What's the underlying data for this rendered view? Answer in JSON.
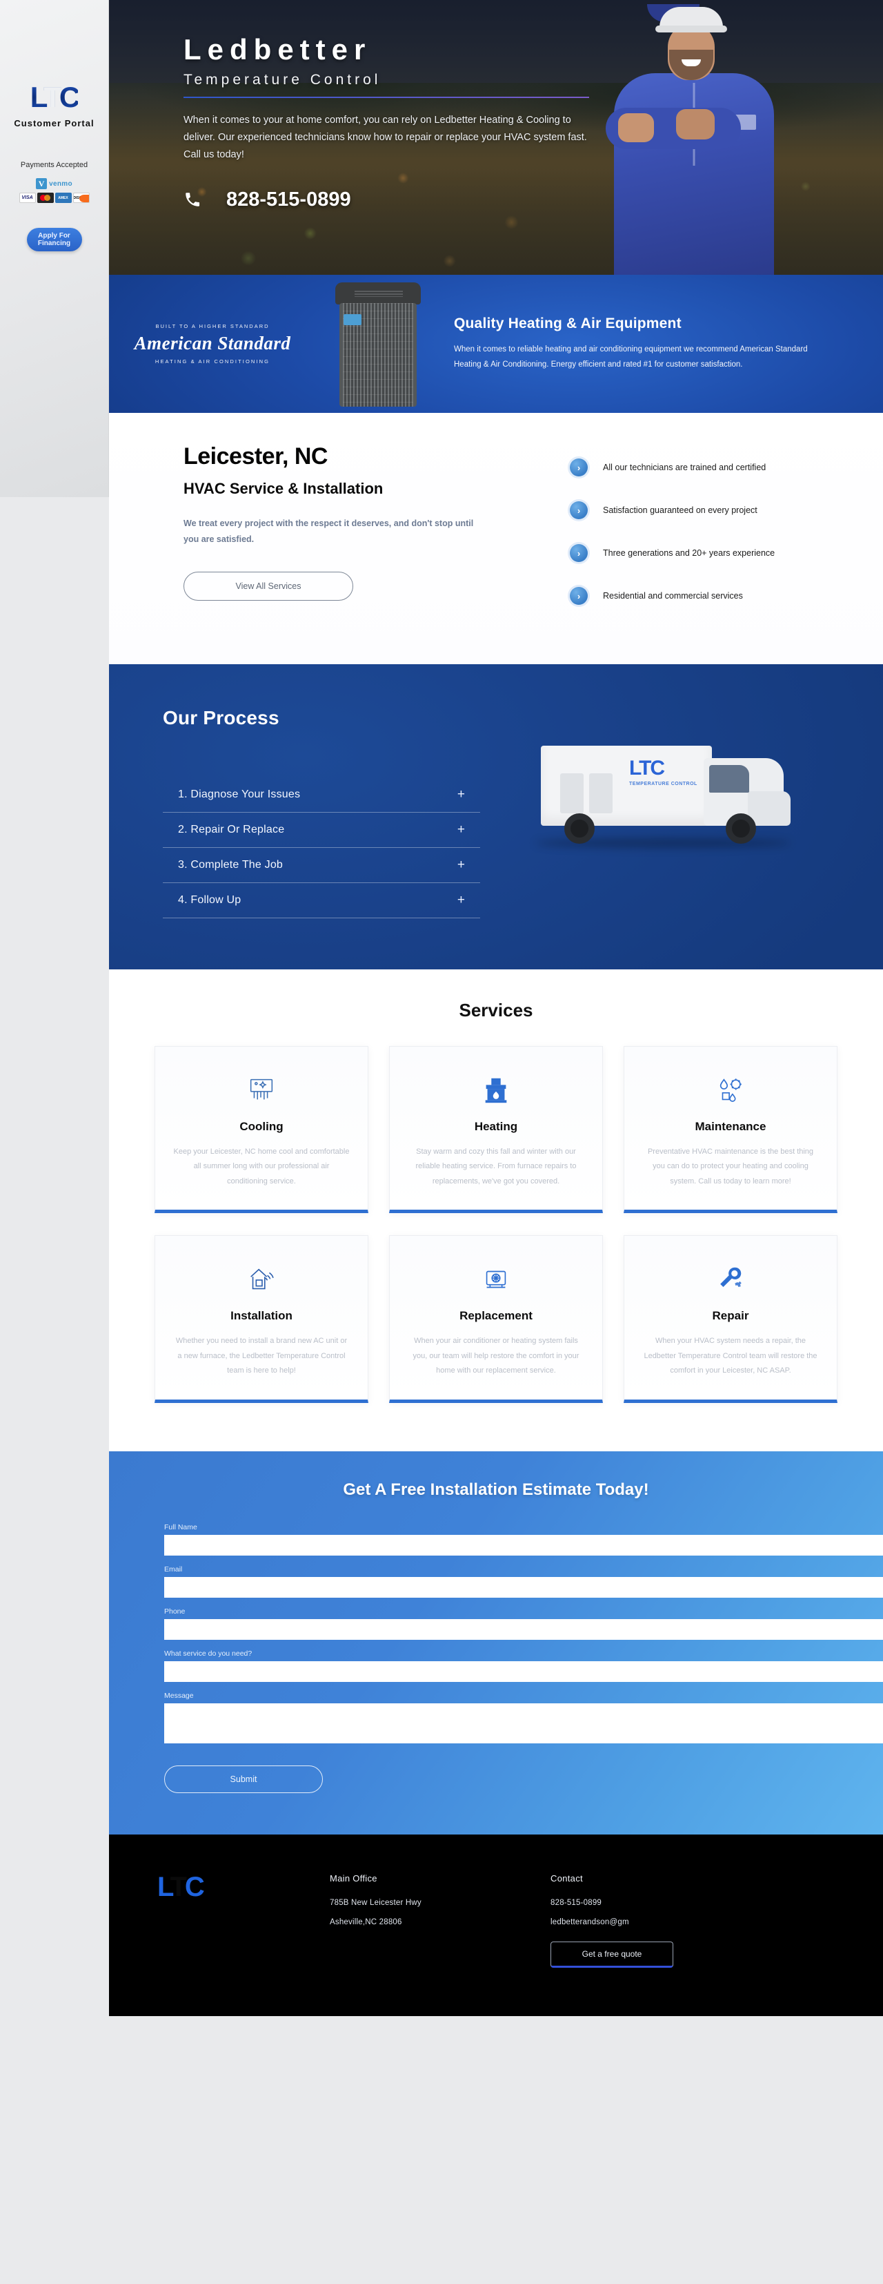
{
  "sidebar": {
    "logo_text": "LTC",
    "portal_label": "Customer Portal",
    "payments_title": "Payments Accepted",
    "payment_badges": [
      {
        "name": "venmo",
        "label": "venmo",
        "mark": "V"
      },
      {
        "name": "visa",
        "label": "VISA"
      },
      {
        "name": "mastercard",
        "label": ""
      },
      {
        "name": "amex",
        "label": "AMEX"
      },
      {
        "name": "discover",
        "label": "DISCVER"
      }
    ],
    "financing_button": "Apply For Financing"
  },
  "hero": {
    "title": "Ledbetter",
    "subtitle": "Temperature Control",
    "lede": "When it comes to your at home comfort, you can rely on Ledbetter Heating & Cooling to deliver. Our experienced technicians know how to repair or replace your HVAC system fast. Call us today!",
    "phone": "828-515-0899",
    "phone_icon": "phone-icon"
  },
  "brand_band": {
    "brand_tagline": "BUILT TO A HIGHER STANDARD",
    "brand_name": "American Standard",
    "brand_sub": "HEATING & AIR CONDITIONING",
    "heading": "Quality Heating & Air Equipment",
    "body": "When it comes to reliable heating and air conditioning equipment we recommend American Standard Heating & Air Conditioning. Energy efficient and rated #1 for customer satisfaction."
  },
  "intro": {
    "city": "Leicester, NC",
    "subtitle": "HVAC Service & Installation",
    "paragraph": "We treat every project with the respect it deserves, and don't stop until you are satisfied.",
    "cta": "View All Services",
    "bullets": [
      "All our technicians are trained and certified",
      "Satisfaction guaranteed on every project",
      "Three generations and 20+ years experience",
      "Residential and commercial services"
    ]
  },
  "process": {
    "heading": "Our Process",
    "steps": [
      {
        "label": "1. Diagnose Your Issues",
        "toggle": "+"
      },
      {
        "label": "2. Repair Or Replace",
        "toggle": "+"
      },
      {
        "label": "3. Complete The Job",
        "toggle": "+"
      },
      {
        "label": "4. Follow Up",
        "toggle": "+"
      }
    ],
    "van_logo": "LTC",
    "van_logo_sub": "TEMPERATURE CONTROL"
  },
  "services": {
    "heading": "Services",
    "cards": [
      {
        "icon": "air-vent-icon",
        "title": "Cooling",
        "body": "Keep your Leicester, NC home cool and comfortable all summer long with our professional air conditioning service."
      },
      {
        "icon": "fireplace-icon",
        "title": "Heating",
        "body": "Stay warm and cozy this fall and winter with our reliable heating service. From furnace repairs to replacements, we've got you covered."
      },
      {
        "icon": "maintenance-gear-icon",
        "title": "Maintenance",
        "body": "Preventative HVAC maintenance is the best thing you can do to protect your heating and cooling system. Call us today to learn more!"
      },
      {
        "icon": "house-install-icon",
        "title": "Installation",
        "body": "Whether you need to install a brand new AC unit or a new furnace, the Ledbetter Temperature Control team is here to help!"
      },
      {
        "icon": "hvac-unit-icon",
        "title": "Replacement",
        "body": "When your air conditioner or heating system fails you, our team will help restore the comfort in your home with our replacement service."
      },
      {
        "icon": "wrench-gear-icon",
        "title": "Repair",
        "body": "When your HVAC system needs a repair, the Ledbetter Temperature Control team will restore the comfort in your Leicester, NC ASAP."
      }
    ]
  },
  "estimate": {
    "heading": "Get A Free Installation Estimate Today!",
    "fields": [
      {
        "name": "full-name",
        "label": "Full Name",
        "value": "",
        "type": "text"
      },
      {
        "name": "email",
        "label": "Email",
        "value": "",
        "type": "text"
      },
      {
        "name": "phone",
        "label": "Phone",
        "value": "",
        "type": "text"
      },
      {
        "name": "service-needed",
        "label": "What service do you need?",
        "value": "",
        "type": "text"
      },
      {
        "name": "message",
        "label": "Message",
        "value": "",
        "type": "textarea"
      }
    ],
    "submit_label": "Submit"
  },
  "footer": {
    "logo_text": "LTC",
    "office_heading": "Main Office",
    "office_line1": "785B New Leicester Hwy",
    "office_line2": "Asheville,NC 28806",
    "contact_heading": "Contact",
    "contact_phone": "828-515-0899",
    "contact_email": "ledbetterandson@gm",
    "quote_button": "Get a free quote"
  },
  "colors": {
    "brand_blue": "#2b64d6",
    "deep_blue": "#153a7d",
    "band_blue": "#1d4ba8",
    "form_blue": "#3f82d8",
    "accent_bullet": "#3a7fc8"
  }
}
